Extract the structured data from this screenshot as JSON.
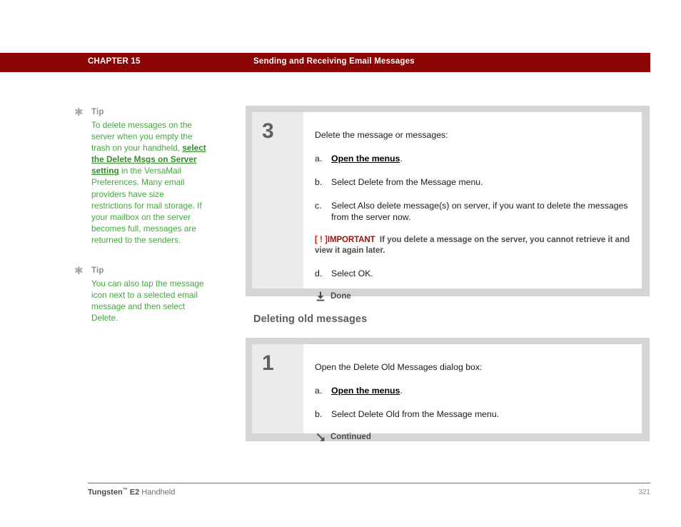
{
  "header": {
    "chapter_label": "CHAPTER 15",
    "chapter_title": "Sending and Receiving Email Messages",
    "bar_color": "#8c0404"
  },
  "sidebar": {
    "tips": [
      {
        "star_glyph": "✱",
        "heading": "Tip",
        "text_before_link": "To delete messages on the server when you empty the trash on your handheld, ",
        "link_text": "select the Delete Msgs on Server setting",
        "text_after_link": " in the VersaMail Preferences. Many email providers have size restrictions for mail storage. If your mailbox on the server becomes full, messages are returned to the senders.",
        "color": "#3faa38"
      },
      {
        "star_glyph": "✱",
        "heading": "Tip",
        "text_before_link": "You can also tap the message icon next to a selected email message and then select Delete.",
        "link_text": "",
        "text_after_link": "",
        "color": "#3faa38"
      }
    ]
  },
  "main": {
    "steps": [
      {
        "number": "3",
        "lead": "Delete the message or messages:",
        "substeps": [
          {
            "marker": "a.",
            "text_before_link": "",
            "link_text": "Open the menus",
            "text_after_link": "."
          },
          {
            "marker": "b.",
            "text_before_link": "Select Delete from the Message menu.",
            "link_text": "",
            "text_after_link": ""
          },
          {
            "marker": "c.",
            "text_before_link": "Select Also delete message(s) on server, if you want to delete the messages from the server now.",
            "link_text": "",
            "text_after_link": ""
          }
        ],
        "note": {
          "bracket_open": "[ ! ]",
          "label": "IMPORTANT",
          "text": "If you delete a message on the server, you cannot retrieve it and view it again later."
        },
        "substeps_after_note": [
          {
            "marker": "d.",
            "text_before_link": "Select OK.",
            "link_text": "",
            "text_after_link": ""
          }
        ],
        "marker": {
          "icon": "down-arrow-bar-icon",
          "label": "Done"
        }
      },
      {
        "number": "1",
        "lead": "Open the Delete Old Messages dialog box:",
        "substeps": [
          {
            "marker": "a.",
            "text_before_link": "",
            "link_text": "Open the menus",
            "text_after_link": "."
          },
          {
            "marker": "b.",
            "text_before_link": "Select Delete Old from the Message menu.",
            "link_text": "",
            "text_after_link": ""
          }
        ],
        "marker": {
          "icon": "diagonal-arrow-icon",
          "label": "Continued"
        }
      }
    ],
    "section_heading": "Deleting old messages"
  },
  "footer": {
    "brand": "Tungsten",
    "trademark": "™",
    "model": " E2",
    "product": " Handheld",
    "page_number": "321"
  }
}
